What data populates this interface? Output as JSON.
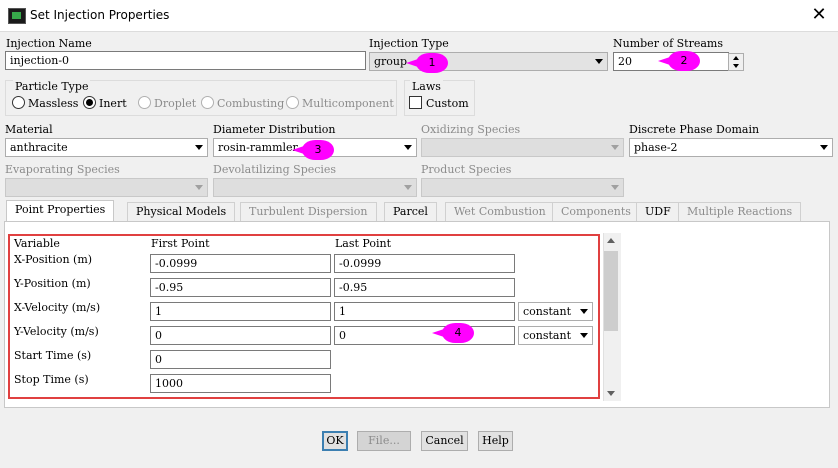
{
  "window": {
    "title": "Set Injection Properties",
    "close_symbol": "✕"
  },
  "injection_name": {
    "label": "Injection Name",
    "value": "injection-0"
  },
  "injection_type": {
    "label": "Injection Type",
    "value": "group"
  },
  "num_streams": {
    "label": "Number of Streams",
    "value": "20"
  },
  "particle_type": {
    "label": "Particle Type",
    "options": [
      "Massless",
      "Inert",
      "Droplet",
      "Combusting",
      "Multicomponent"
    ],
    "selected": "Inert"
  },
  "laws": {
    "label": "Laws",
    "custom_label": "Custom"
  },
  "material": {
    "label": "Material",
    "value": "anthracite"
  },
  "diameter_distribution": {
    "label": "Diameter Distribution",
    "value": "rosin-rammler"
  },
  "oxidizing_species": {
    "label": "Oxidizing Species",
    "value": ""
  },
  "discrete_phase_domain": {
    "label": "Discrete Phase Domain",
    "value": "phase-2"
  },
  "evaporating_species": {
    "label": "Evaporating Species",
    "value": ""
  },
  "devolatilizing_species": {
    "label": "Devolatilizing Species",
    "value": ""
  },
  "product_species": {
    "label": "Product Species",
    "value": ""
  },
  "tabs": [
    "Point Properties",
    "Physical Models",
    "Turbulent Dispersion",
    "Parcel",
    "Wet Combustion",
    "Components",
    "UDF",
    "Multiple Reactions"
  ],
  "point_properties": {
    "col_variable": "Variable",
    "col_first": "First Point",
    "col_last": "Last Point",
    "rows": [
      {
        "label": "X-Position (m)",
        "first": "-0.0999",
        "last": "-0.0999",
        "mode": ""
      },
      {
        "label": "Y-Position (m)",
        "first": "-0.95",
        "last": "-0.95",
        "mode": ""
      },
      {
        "label": "X-Velocity (m/s)",
        "first": "1",
        "last": "1",
        "mode": "constant"
      },
      {
        "label": "Y-Velocity (m/s)",
        "first": "0",
        "last": "0",
        "mode": "constant"
      },
      {
        "label": "Start Time (s)",
        "first": "0",
        "last": "",
        "mode": ""
      },
      {
        "label": "Stop Time (s)",
        "first": "1000",
        "last": "",
        "mode": ""
      }
    ]
  },
  "buttons": {
    "ok": "OK",
    "file": "File...",
    "cancel": "Cancel",
    "help": "Help"
  },
  "annotations": [
    "1",
    "2",
    "3",
    "4"
  ],
  "colors": {
    "annotation": "#ff00ff",
    "highlight_box": "#e04040"
  }
}
